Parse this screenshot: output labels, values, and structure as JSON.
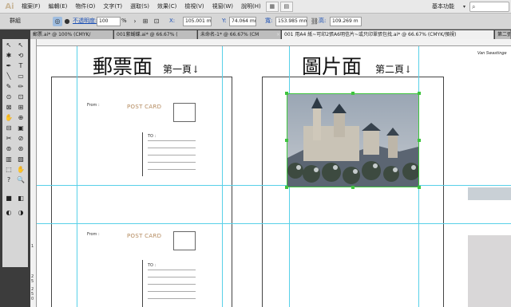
{
  "app": {
    "logo": "Ai",
    "workspace": "基本功能",
    "workspace_arrow": "▾"
  },
  "menus": [
    "檔案(F)",
    "編輯(E)",
    "物件(O)",
    "文字(T)",
    "選取(S)",
    "效果(C)",
    "檢視(V)",
    "視窗(W)",
    "說明(H)"
  ],
  "menu_icons": [
    "▦",
    "▤"
  ],
  "control": {
    "selection_label": "群組",
    "opacity_label": "不透明度:",
    "opacity_value": "100",
    "opacity_unit": "%",
    "x_label": "X:",
    "x_value": "105.001 mm",
    "y_label": "Y:",
    "y_value": "74.064 mm",
    "w_label": "寬:",
    "w_value": "153.985 mm",
    "h_label": "高:",
    "h_value": "109.269 m"
  },
  "tabs": [
    {
      "label": "郵票.ai* @ 100% (CMYK/"
    },
    {
      "label": "001紫蝴蝶.ai* @ 66.67% ("
    },
    {
      "label": "未命名-1* @ 66.67% (CM"
    },
    {
      "label": "001 用A4 紙~可印2張A6明信片~或只印單張包找.ai* @ 66.67% (CMYK/預視)"
    },
    {
      "label": "第二張"
    }
  ],
  "tab_close": "×",
  "ruler": {
    "v_labels": [
      "1",
      "2",
      "5",
      "2",
      "5",
      "0"
    ]
  },
  "pages": {
    "front_title": "郵票面",
    "front_subtitle": "第一頁↓",
    "back_title": "圖片面",
    "back_subtitle": "第二頁↓",
    "from_label": "From :",
    "postcard_label": "POST CARD",
    "to_label": "TO :",
    "corner_text": "Van Swastinge"
  },
  "tools": [
    "↖",
    "↖",
    "✱",
    "⟲",
    "✒",
    "T",
    "╲",
    "▭",
    "✎",
    "✏",
    "⊙",
    "⊡",
    "⊠",
    "⊞",
    "✋",
    "⊕",
    "⊟",
    "▣",
    "✂",
    "⊘",
    "⊚",
    "⊛",
    "▥",
    "▨",
    "⬚",
    "✋",
    "?",
    "🔍",
    "■",
    "◧",
    "◐",
    "◑"
  ],
  "colors": {
    "accent": "#3ec53e",
    "guide": "#58d0e8",
    "postcard_text": "#b48a5e"
  }
}
